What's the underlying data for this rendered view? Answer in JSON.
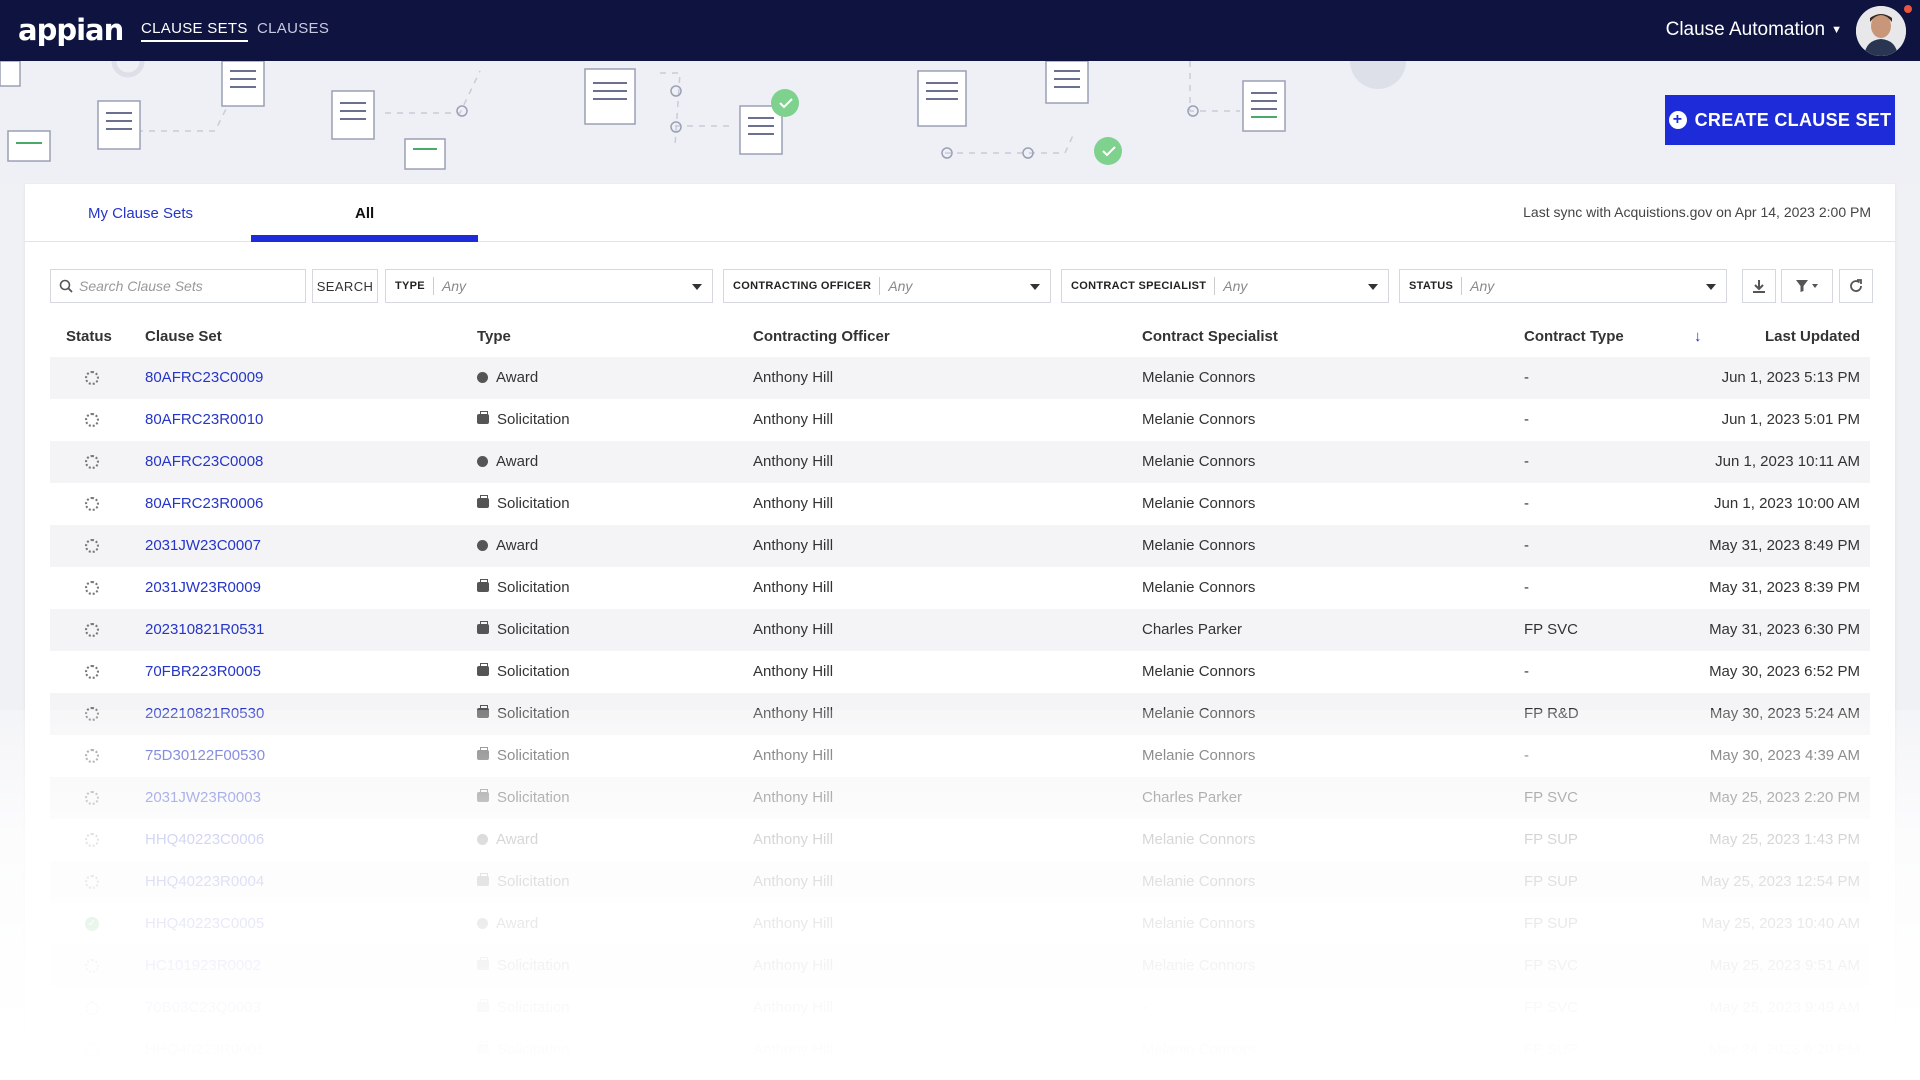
{
  "nav": {
    "logo": "appian",
    "tabs": [
      {
        "label": "CLAUSE SETS",
        "active": true
      },
      {
        "label": "CLAUSES",
        "active": false
      }
    ],
    "app_menu": "Clause Automation"
  },
  "banner": {
    "create_button": "CREATE CLAUSE SET"
  },
  "tabs": {
    "mine": "My Clause Sets",
    "all": "All",
    "active": "All"
  },
  "sync_text": "Last sync with Acquistions.gov on Apr 14, 2023 2:00 PM",
  "filters": {
    "search_placeholder": "Search Clause Sets",
    "search_button": "SEARCH",
    "type_label": "TYPE",
    "type_value": "Any",
    "officer_label": "CONTRACTING OFFICER",
    "officer_value": "Any",
    "specialist_label": "CONTRACT SPECIALIST",
    "specialist_value": "Any",
    "status_label": "STATUS",
    "status_value": "Any"
  },
  "table": {
    "columns": {
      "status": "Status",
      "clause_set": "Clause Set",
      "type": "Type",
      "officer": "Contracting Officer",
      "specialist": "Contract Specialist",
      "contract_type": "Contract Type",
      "last_updated": "Last Updated"
    },
    "rows": [
      {
        "status": "in-progress",
        "id": "80AFRC23C0009",
        "type": "Award",
        "officer": "Anthony Hill",
        "specialist": "Melanie Connors",
        "contract_type": "-",
        "updated": "Jun 1, 2023 5:13 PM"
      },
      {
        "status": "in-progress",
        "id": "80AFRC23R0010",
        "type": "Solicitation",
        "officer": "Anthony Hill",
        "specialist": "Melanie Connors",
        "contract_type": "-",
        "updated": "Jun 1, 2023 5:01 PM"
      },
      {
        "status": "in-progress",
        "id": "80AFRC23C0008",
        "type": "Award",
        "officer": "Anthony Hill",
        "specialist": "Melanie Connors",
        "contract_type": "-",
        "updated": "Jun 1, 2023 10:11 AM"
      },
      {
        "status": "in-progress",
        "id": "80AFRC23R0006",
        "type": "Solicitation",
        "officer": "Anthony Hill",
        "specialist": "Melanie Connors",
        "contract_type": "-",
        "updated": "Jun 1, 2023 10:00 AM"
      },
      {
        "status": "in-progress",
        "id": "2031JW23C0007",
        "type": "Award",
        "officer": "Anthony Hill",
        "specialist": "Melanie Connors",
        "contract_type": "-",
        "updated": "May 31, 2023 8:49 PM"
      },
      {
        "status": "in-progress",
        "id": "2031JW23R0009",
        "type": "Solicitation",
        "officer": "Anthony Hill",
        "specialist": "Melanie Connors",
        "contract_type": "-",
        "updated": "May 31, 2023 8:39 PM"
      },
      {
        "status": "in-progress",
        "id": "202310821R0531",
        "type": "Solicitation",
        "officer": "Anthony Hill",
        "specialist": "Charles Parker",
        "contract_type": "FP SVC",
        "updated": "May 31, 2023 6:30 PM"
      },
      {
        "status": "in-progress",
        "id": "70FBR223R0005",
        "type": "Solicitation",
        "officer": "Anthony Hill",
        "specialist": "Melanie Connors",
        "contract_type": "-",
        "updated": "May 30, 2023 6:52 PM"
      },
      {
        "status": "in-progress",
        "id": "202210821R0530",
        "type": "Solicitation",
        "officer": "Anthony Hill",
        "specialist": "Melanie Connors",
        "contract_type": "FP R&D",
        "updated": "May 30, 2023 5:24 AM"
      },
      {
        "status": "in-progress",
        "id": "75D30122F00530",
        "type": "Solicitation",
        "officer": "Anthony Hill",
        "specialist": "Melanie Connors",
        "contract_type": "-",
        "updated": "May 30, 2023 4:39 AM"
      },
      {
        "status": "in-progress",
        "id": "2031JW23R0003",
        "type": "Solicitation",
        "officer": "Anthony Hill",
        "specialist": "Charles Parker",
        "contract_type": "FP SVC",
        "updated": "May 25, 2023 2:20 PM"
      },
      {
        "status": "in-progress",
        "id": "HHQ40223C0006",
        "type": "Award",
        "officer": "Anthony Hill",
        "specialist": "Melanie Connors",
        "contract_type": "FP SUP",
        "updated": "May 25, 2023 1:43 PM"
      },
      {
        "status": "in-progress",
        "id": "HHQ40223R0004",
        "type": "Solicitation",
        "officer": "Anthony Hill",
        "specialist": "Melanie Connors",
        "contract_type": "FP SUP",
        "updated": "May 25, 2023 12:54 PM"
      },
      {
        "status": "complete",
        "id": "HHQ40223C0005",
        "type": "Award",
        "officer": "Anthony Hill",
        "specialist": "Melanie Connors",
        "contract_type": "FP SUP",
        "updated": "May 25, 2023 10:40 AM"
      },
      {
        "status": "in-progress",
        "id": "HC101923R0002",
        "type": "Solicitation",
        "officer": "Anthony Hill",
        "specialist": "Melanie Connors",
        "contract_type": "FP SVC",
        "updated": "May 25, 2023 9:51 AM"
      },
      {
        "status": "in-progress",
        "id": "70B03C23Q0003",
        "type": "Solicitation",
        "officer": "Anthony Hill",
        "specialist": "-",
        "contract_type": "FP SVC",
        "updated": "May 25, 2023 9:49 AM"
      },
      {
        "status": "in-progress",
        "id": "HHQ40223R0001",
        "type": "Solicitation",
        "officer": "Anthony Hill",
        "specialist": "Melanie Connors",
        "contract_type": "FP SUP",
        "updated": "May 24, 2023 6:20 PM"
      }
    ]
  },
  "colors": {
    "nav_bg": "#0f1340",
    "accent": "#1d2bd8",
    "link": "#2535c9",
    "success": "#3aa84a"
  }
}
